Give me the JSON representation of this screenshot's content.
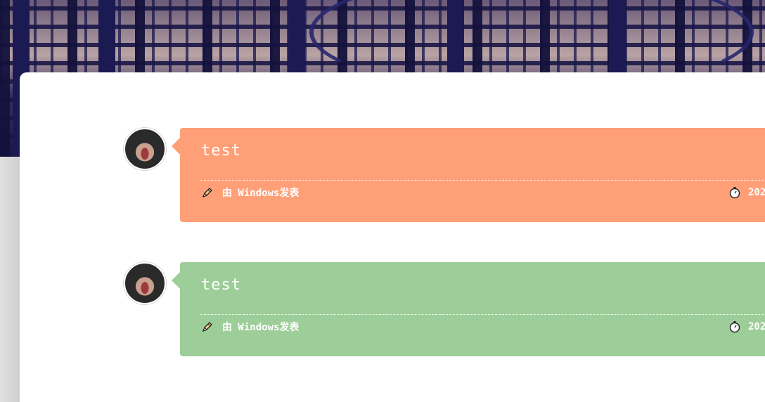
{
  "entries": [
    {
      "title": "test",
      "author_line": "由 Windows发表",
      "date": "202",
      "color": "#ff9f77"
    },
    {
      "title": "test",
      "author_line": "由 Windows发表",
      "date": "202",
      "color": "#9dcd98"
    }
  ],
  "icons": {
    "author": "pen-icon",
    "date": "stopwatch-icon",
    "avatar": "avatar"
  }
}
